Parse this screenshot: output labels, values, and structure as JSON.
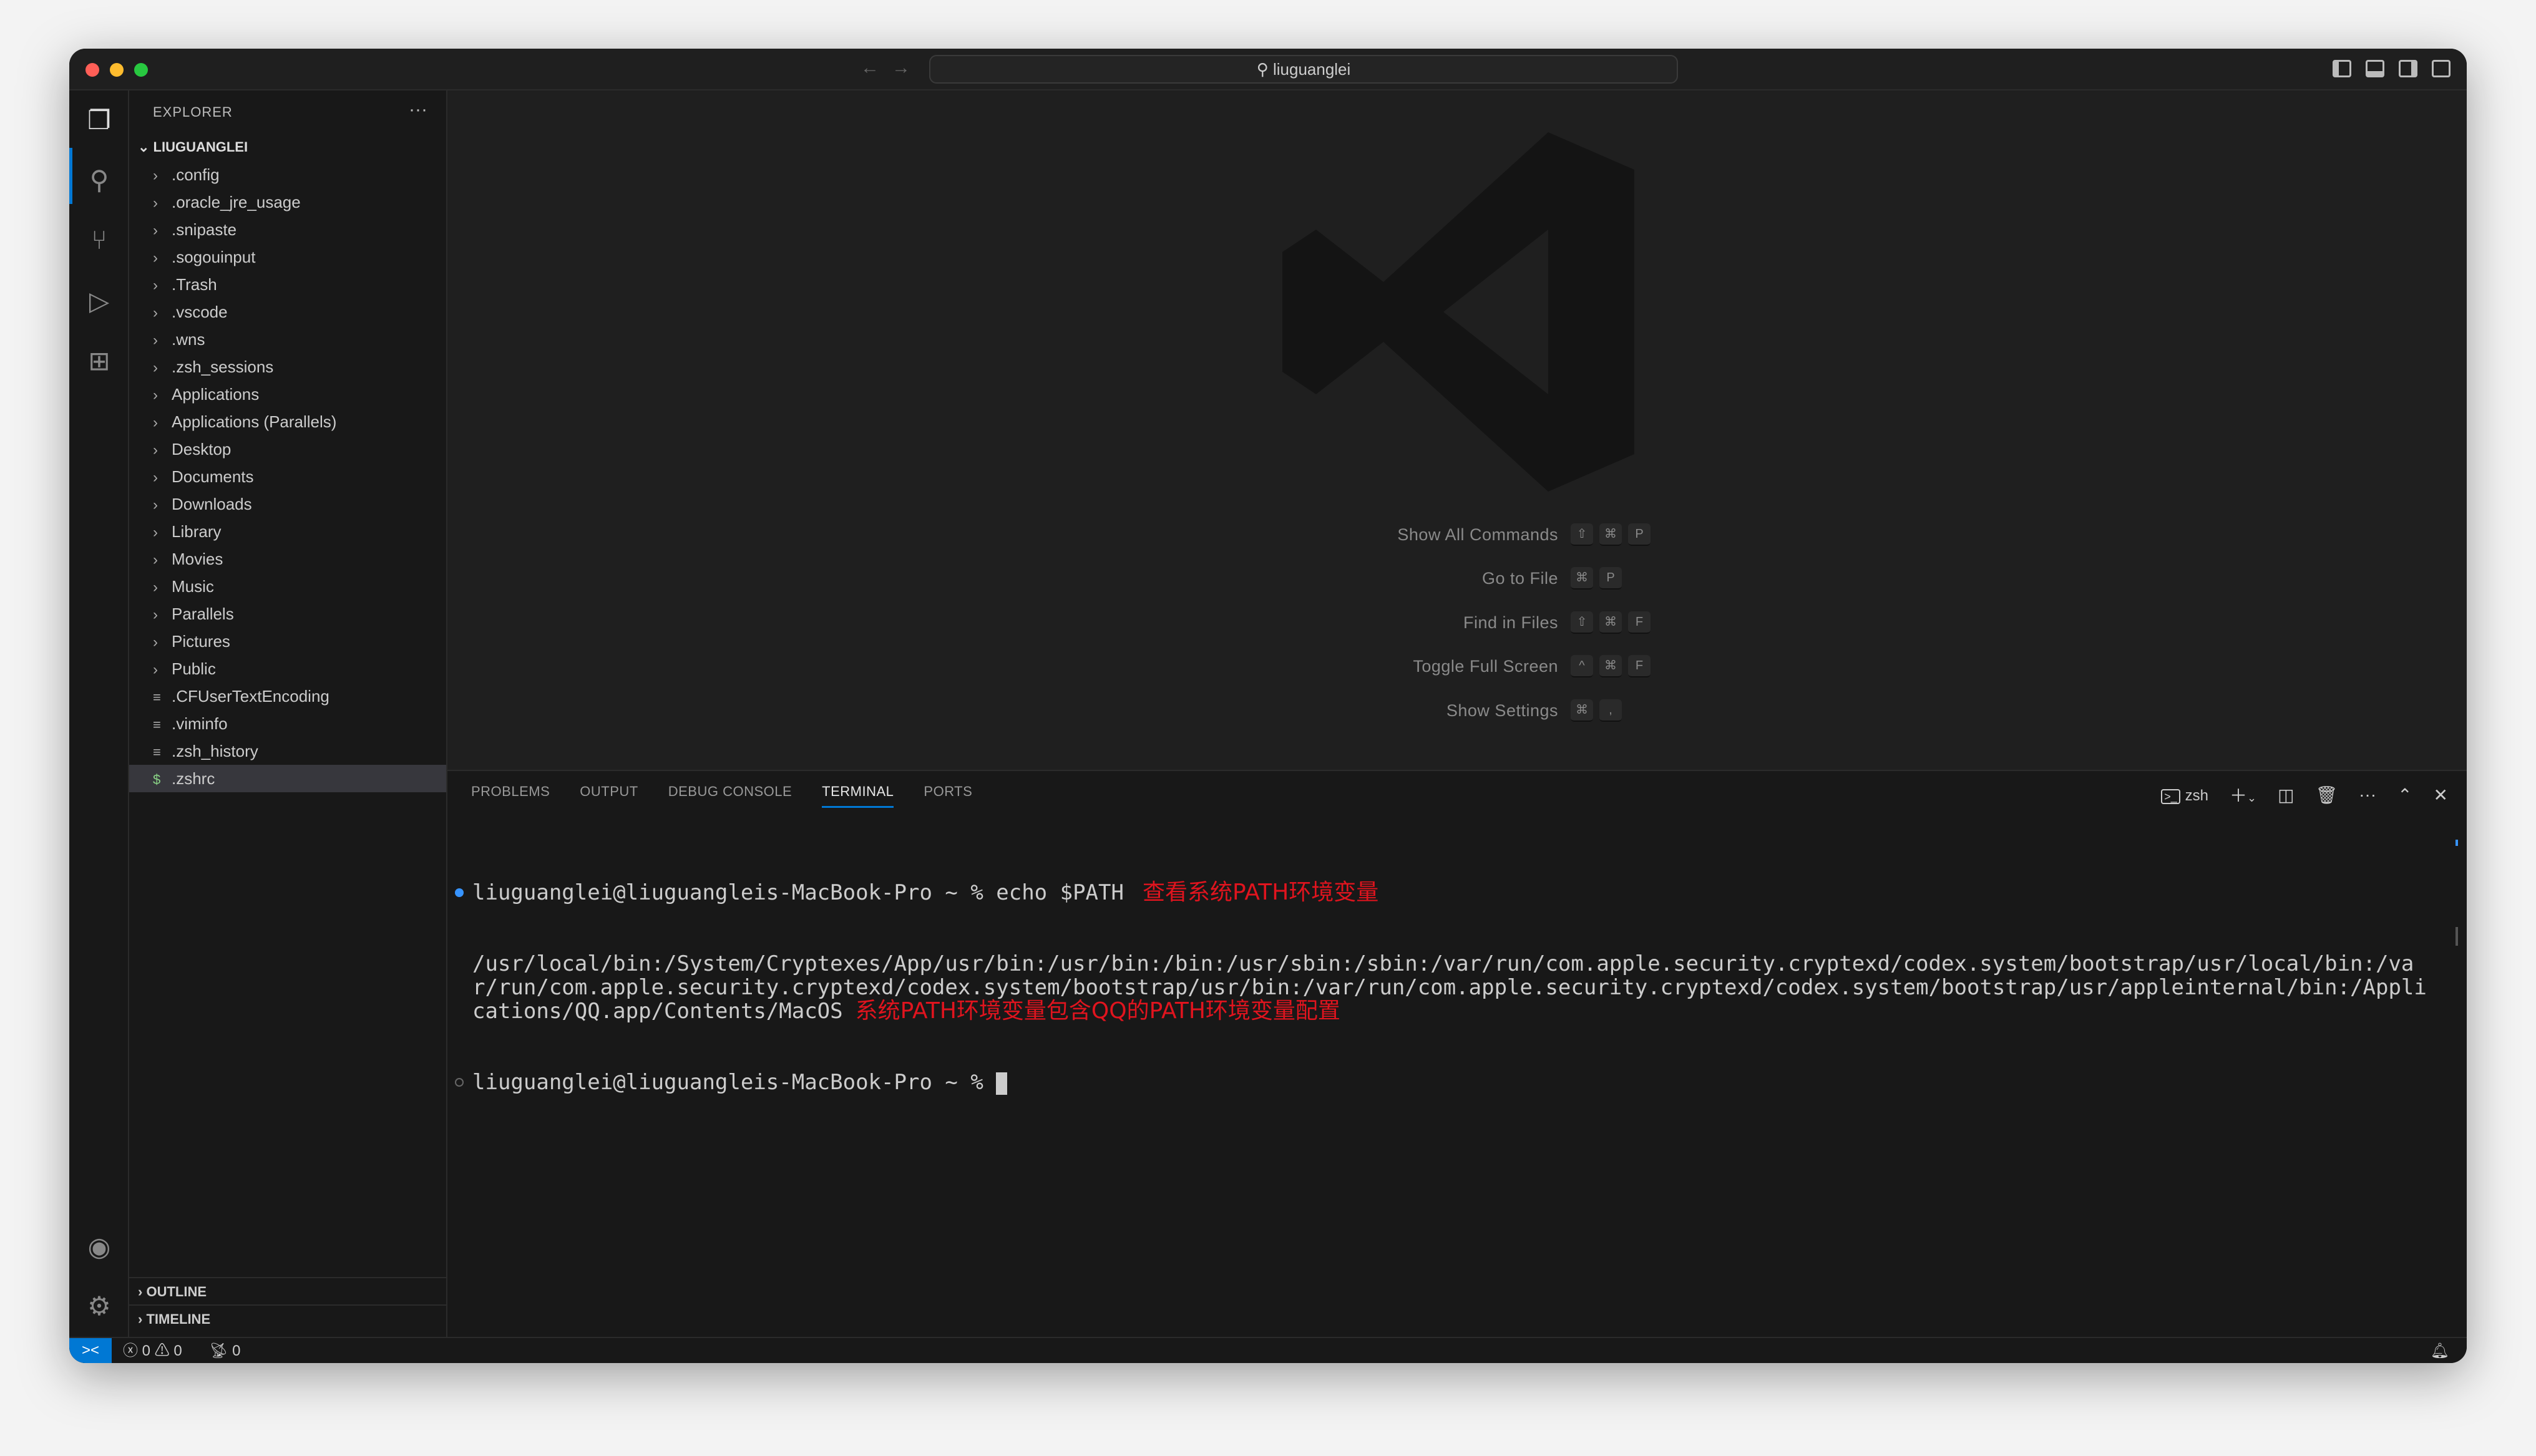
{
  "titlebar": {
    "search_text": "liuguanglei",
    "search_icon": "search-icon"
  },
  "explorer": {
    "title": "EXPLORER",
    "root": "LIUGUANGLEI",
    "items": [
      {
        "label": ".config",
        "type": "folder"
      },
      {
        "label": ".oracle_jre_usage",
        "type": "folder"
      },
      {
        "label": ".snipaste",
        "type": "folder"
      },
      {
        "label": ".sogouinput",
        "type": "folder"
      },
      {
        "label": ".Trash",
        "type": "folder"
      },
      {
        "label": ".vscode",
        "type": "folder"
      },
      {
        "label": ".wns",
        "type": "folder"
      },
      {
        "label": ".zsh_sessions",
        "type": "folder"
      },
      {
        "label": "Applications",
        "type": "folder"
      },
      {
        "label": "Applications (Parallels)",
        "type": "folder"
      },
      {
        "label": "Desktop",
        "type": "folder"
      },
      {
        "label": "Documents",
        "type": "folder"
      },
      {
        "label": "Downloads",
        "type": "folder"
      },
      {
        "label": "Library",
        "type": "folder"
      },
      {
        "label": "Movies",
        "type": "folder"
      },
      {
        "label": "Music",
        "type": "folder"
      },
      {
        "label": "Parallels",
        "type": "folder"
      },
      {
        "label": "Pictures",
        "type": "folder"
      },
      {
        "label": "Public",
        "type": "folder"
      },
      {
        "label": ".CFUserTextEncoding",
        "type": "file"
      },
      {
        "label": ".viminfo",
        "type": "file"
      },
      {
        "label": ".zsh_history",
        "type": "file"
      },
      {
        "label": ".zshrc",
        "type": "shell-file",
        "selected": true
      }
    ],
    "outline": "OUTLINE",
    "timeline": "TIMELINE"
  },
  "welcome": {
    "shortcuts": [
      {
        "label": "Show All Commands",
        "keys": [
          "⇧",
          "⌘",
          "P"
        ]
      },
      {
        "label": "Go to File",
        "keys": [
          "⌘",
          "P"
        ]
      },
      {
        "label": "Find in Files",
        "keys": [
          "⇧",
          "⌘",
          "F"
        ]
      },
      {
        "label": "Toggle Full Screen",
        "keys": [
          "^",
          "⌘",
          "F"
        ]
      },
      {
        "label": "Show Settings",
        "keys": [
          "⌘",
          ","
        ]
      }
    ]
  },
  "panel": {
    "tabs": [
      "PROBLEMS",
      "OUTPUT",
      "DEBUG CONSOLE",
      "TERMINAL",
      "PORTS"
    ],
    "active_tab": "TERMINAL",
    "shell": "zsh"
  },
  "terminal": {
    "line1_prompt": "liuguanglei@liuguangleis-MacBook-Pro ~ % echo $PATH",
    "line1_annotation": "查看系统PATH环境变量",
    "output": "/usr/local/bin:/System/Cryptexes/App/usr/bin:/usr/bin:/bin:/usr/sbin:/sbin:/var/run/com.apple.security.cryptexd/codex.system/bootstrap/usr/local/bin:/var/run/com.apple.security.cryptexd/codex.system/bootstrap/usr/bin:/var/run/com.apple.security.cryptexd/codex.system/bootstrap/usr/appleinternal/bin:/Applications/QQ.app/Contents/MacOS",
    "output_annotation": "系统PATH环境变量包含QQ的PATH环境变量配置",
    "prompt2": "liuguanglei@liuguangleis-MacBook-Pro ~ % "
  },
  "status": {
    "errors": "0",
    "warnings": "0",
    "ports": "0"
  },
  "colors": {
    "accent": "#0078d4",
    "annotation": "#e0141e"
  }
}
